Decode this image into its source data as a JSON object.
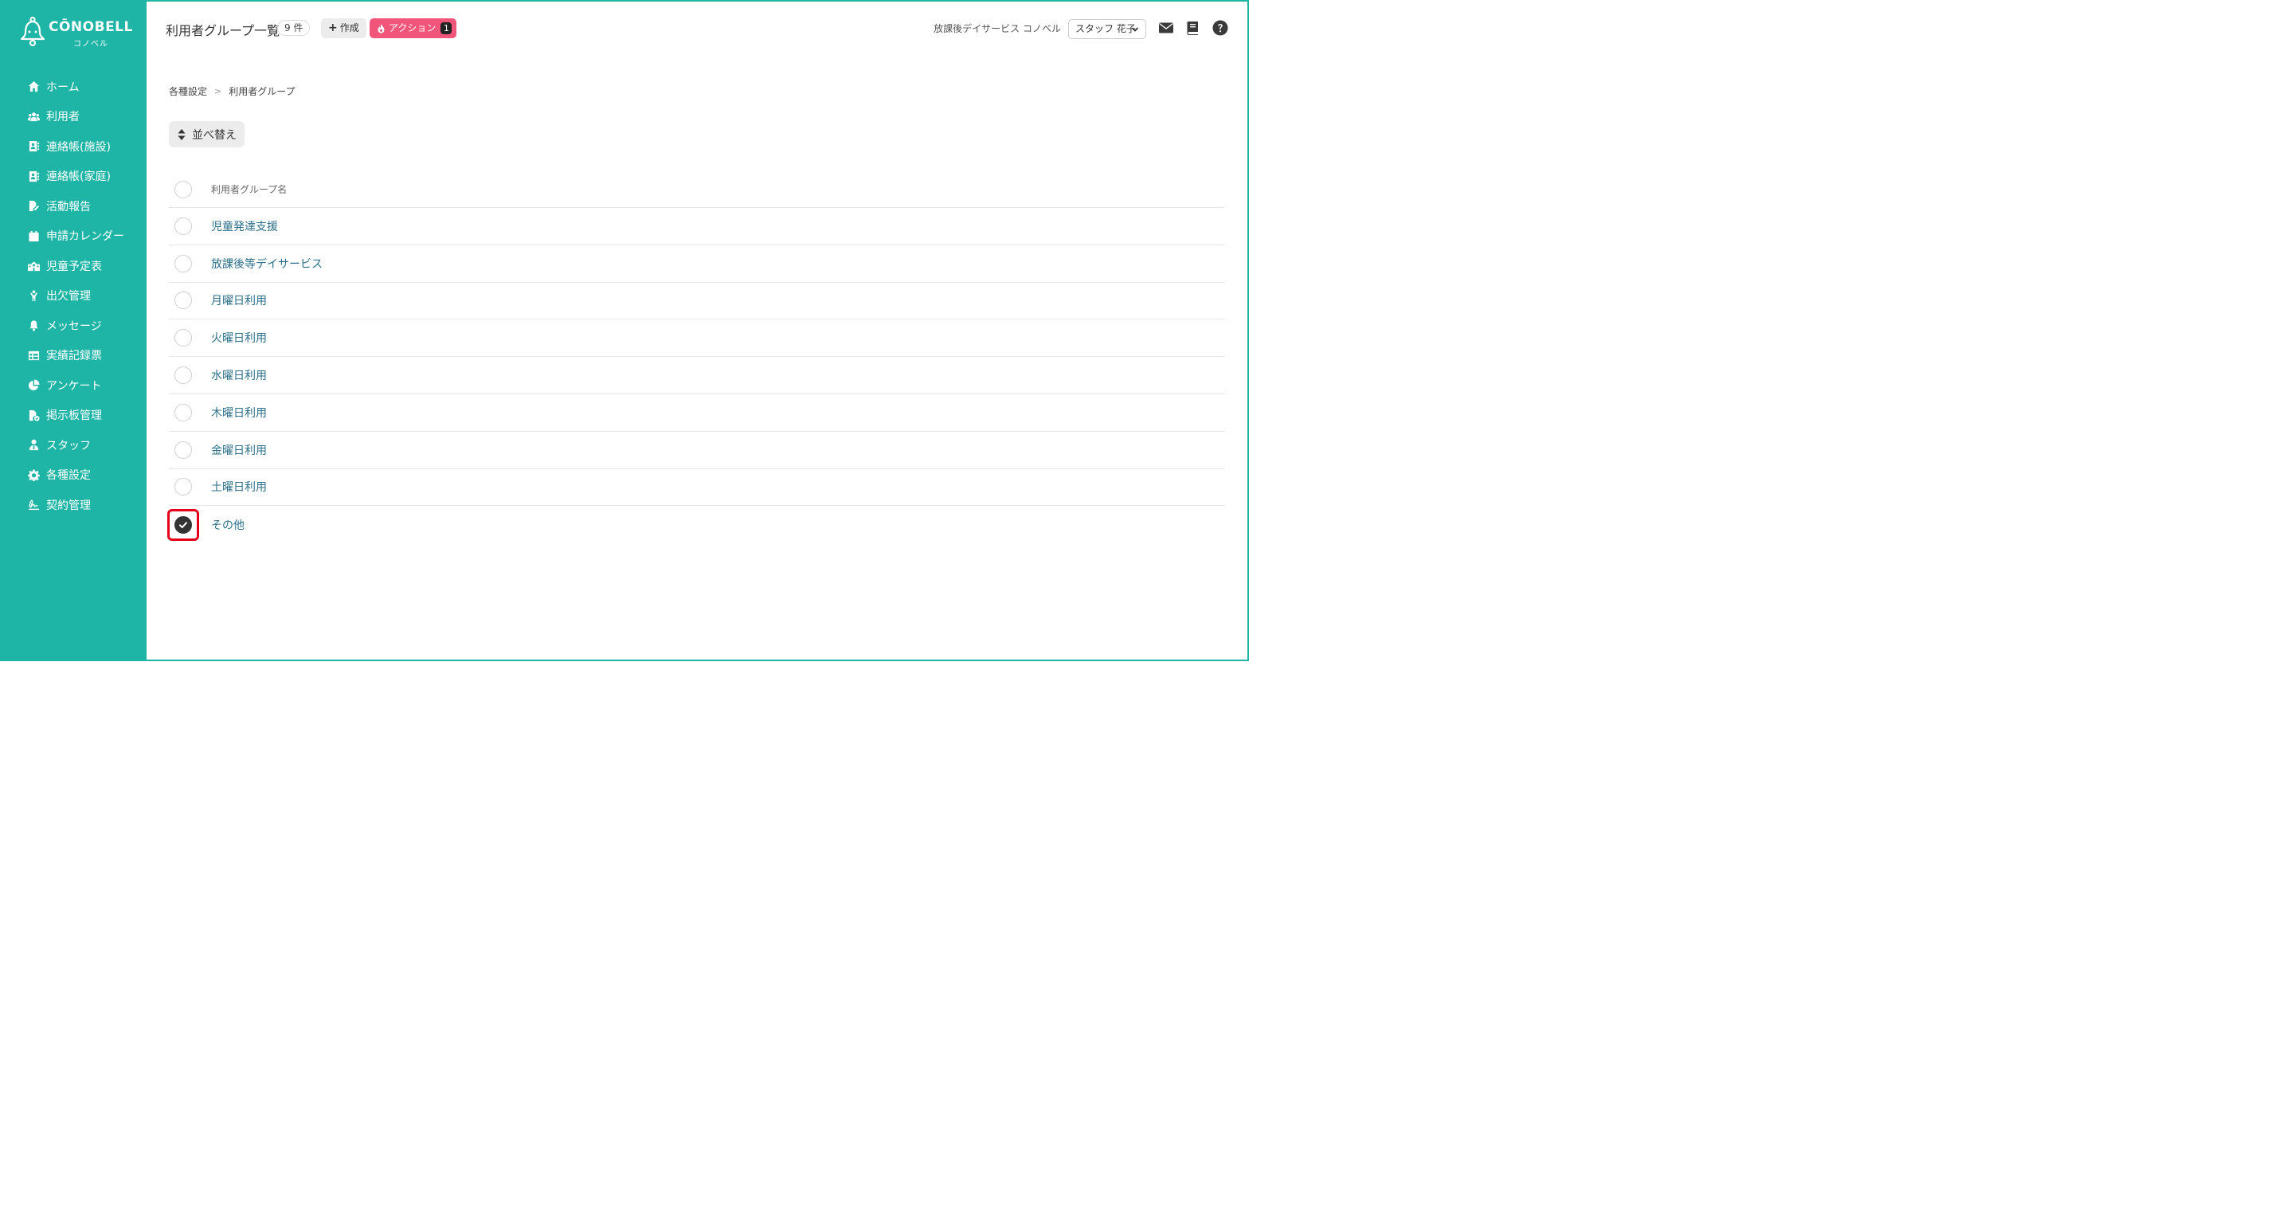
{
  "brand": {
    "logo_text": "CŌNOBELL",
    "logo_sub": "コノベル"
  },
  "sidebar": {
    "items": [
      {
        "label": "ホーム",
        "icon": "home-icon"
      },
      {
        "label": "利用者",
        "icon": "users-icon"
      },
      {
        "label": "連絡帳(施設)",
        "icon": "contact-book-icon"
      },
      {
        "label": "連絡帳(家庭)",
        "icon": "contact-book-icon"
      },
      {
        "label": "活動報告",
        "icon": "file-edit-icon"
      },
      {
        "label": "申請カレンダー",
        "icon": "calendar-icon"
      },
      {
        "label": "児童予定表",
        "icon": "school-icon"
      },
      {
        "label": "出欠管理",
        "icon": "child-icon"
      },
      {
        "label": "メッセージ",
        "icon": "bell-icon"
      },
      {
        "label": "実績記録票",
        "icon": "table-icon"
      },
      {
        "label": "アンケート",
        "icon": "pie-chart-icon"
      },
      {
        "label": "掲示板管理",
        "icon": "file-check-icon"
      },
      {
        "label": "スタッフ",
        "icon": "user-tie-icon"
      },
      {
        "label": "各種設定",
        "icon": "gear-icon"
      },
      {
        "label": "契約管理",
        "icon": "signature-icon"
      }
    ]
  },
  "header": {
    "title": "利用者グループ一覧",
    "count": "9 件",
    "create_label": "作成",
    "action_label": "アクション",
    "action_count": "1",
    "facility": "放課後デイサービス コノベル",
    "staff": "スタッフ 花子"
  },
  "breadcrumb": {
    "parent": "各種設定",
    "current": "利用者グループ"
  },
  "sort_label": "並べ替え",
  "table": {
    "column_header": "利用者グループ名",
    "rows": [
      {
        "name": "児童発達支援",
        "checked": false
      },
      {
        "name": "放課後等デイサービス",
        "checked": false
      },
      {
        "name": "月曜日利用",
        "checked": false
      },
      {
        "name": "火曜日利用",
        "checked": false
      },
      {
        "name": "水曜日利用",
        "checked": false
      },
      {
        "name": "木曜日利用",
        "checked": false
      },
      {
        "name": "金曜日利用",
        "checked": false
      },
      {
        "name": "土曜日利用",
        "checked": false
      },
      {
        "name": "その他",
        "checked": true
      }
    ]
  },
  "colors": {
    "sidebar_bg": "#1fb5a6",
    "action_bg": "#f2557a",
    "link": "#2b6f8a",
    "highlight": "#e6001a"
  }
}
